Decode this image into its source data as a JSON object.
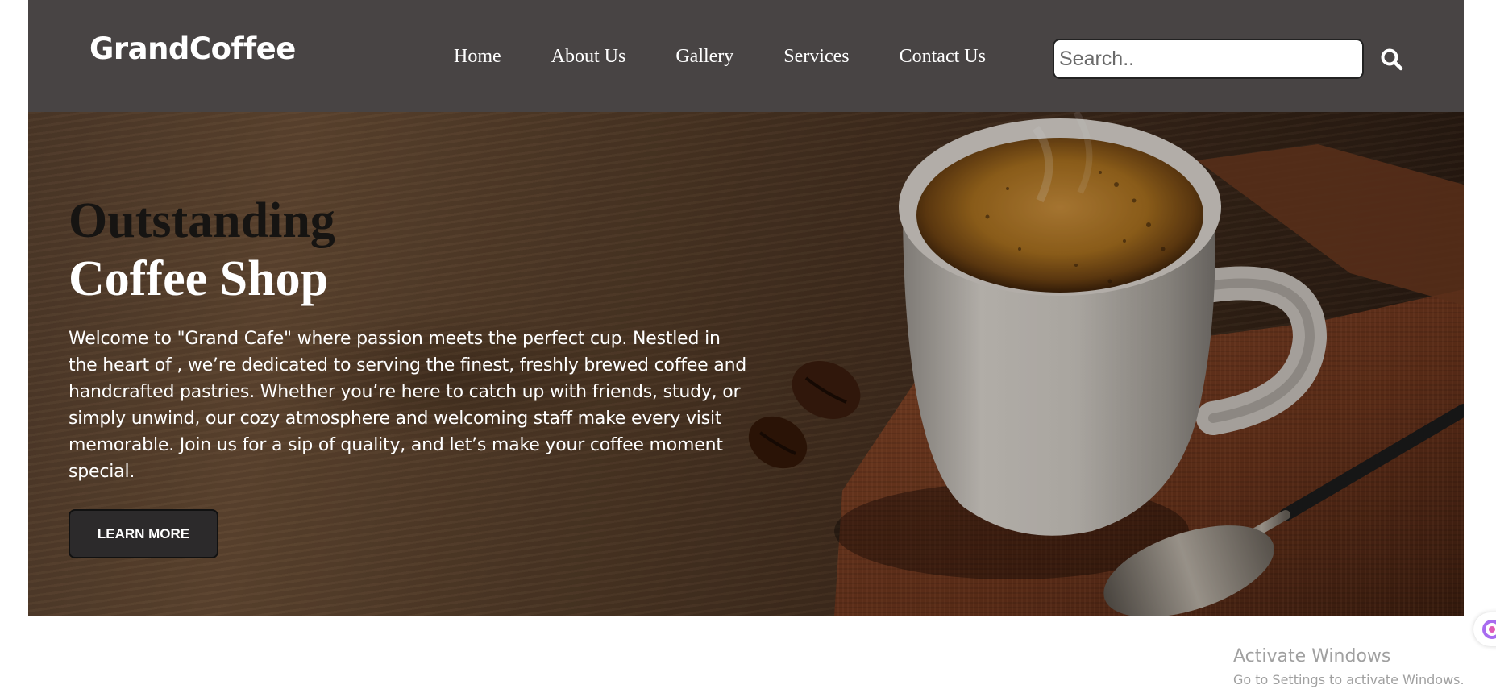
{
  "header": {
    "logo": "GrandCoffee",
    "nav": [
      {
        "label": "Home"
      },
      {
        "label": "About Us"
      },
      {
        "label": "Gallery"
      },
      {
        "label": "Services"
      },
      {
        "label": "Contact Us"
      }
    ],
    "search": {
      "placeholder": "Search..",
      "value": "",
      "button_icon": "search-icon"
    }
  },
  "hero": {
    "title_line1": "Outstanding",
    "title_line2": "Coffee Shop",
    "description": "Welcome to \"Grand Cafe\" where passion meets the perfect cup. Nestled in the heart of , we’re dedicated to serving the finest, freshly brewed coffee and handcrafted pastries. Whether you’re here to catch up with friends, study, or simply unwind, our cozy atmosphere and welcoming staff make every visit memorable. Join us for a sip of quality, and let’s make your coffee moment special.",
    "cta_label": "LEARN MORE",
    "background": "coffee-cup-with-beans-image"
  },
  "os_watermark": {
    "title": "Activate Windows",
    "subtitle": "Go to Settings to activate Windows."
  },
  "colors": {
    "header_bg": "#484444",
    "button_bg": "#2c2a2b",
    "page_bg": "#ffffff"
  }
}
